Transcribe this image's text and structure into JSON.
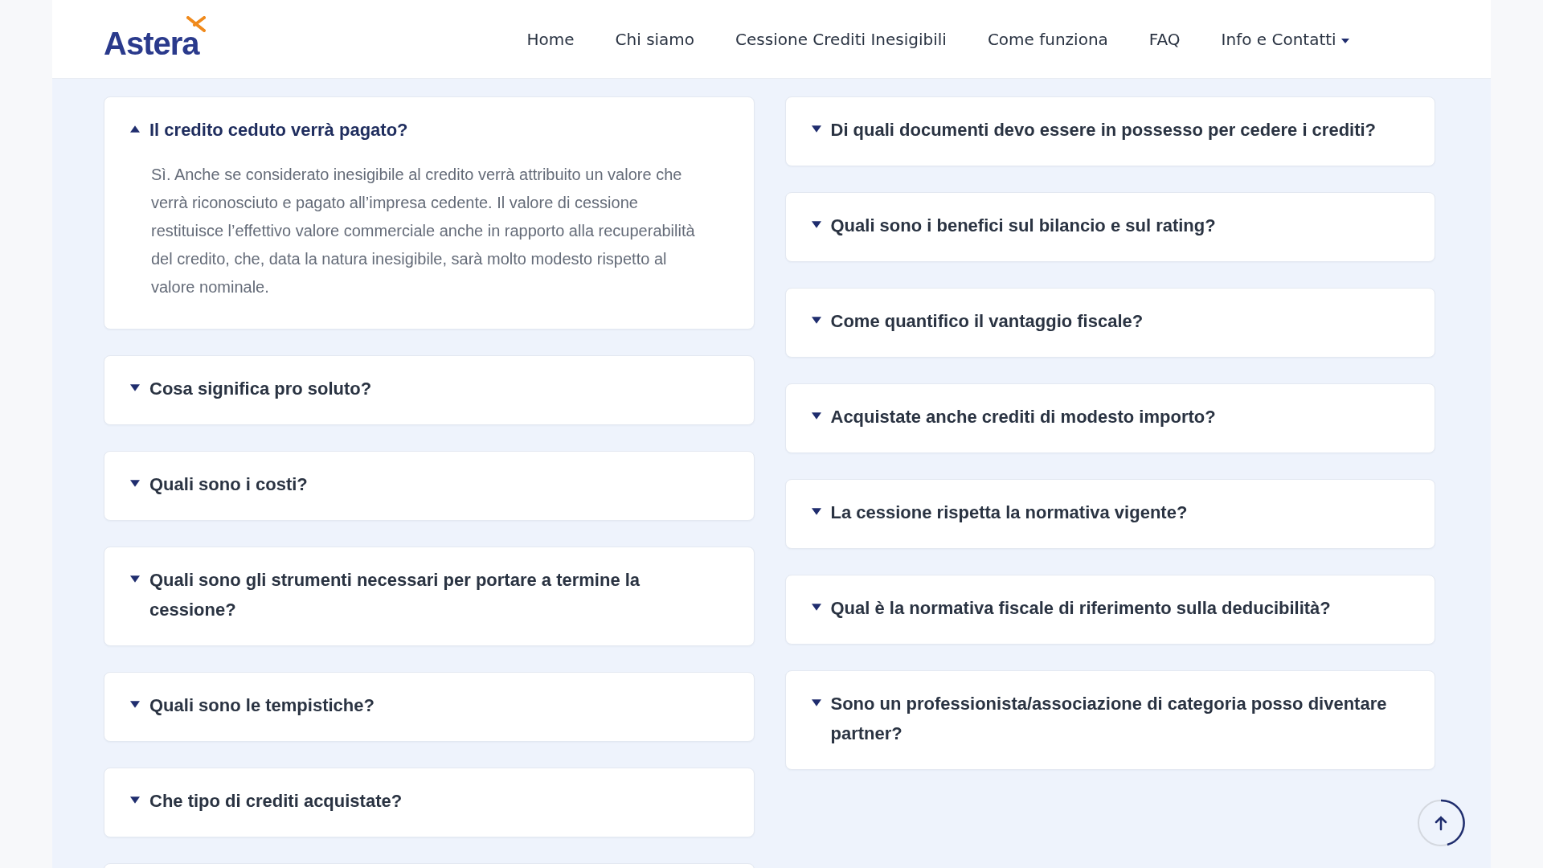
{
  "logo": {
    "name": "Astera"
  },
  "nav": [
    {
      "label": "Home",
      "dropdown": false
    },
    {
      "label": "Chi siamo",
      "dropdown": false
    },
    {
      "label": "Cessione Crediti Inesigibili",
      "dropdown": false
    },
    {
      "label": "Come funziona",
      "dropdown": false
    },
    {
      "label": "FAQ",
      "dropdown": false
    },
    {
      "label": "Info e Contatti",
      "dropdown": true
    }
  ],
  "faq_left": [
    {
      "question": "Il credito ceduto verrà pagato?",
      "expanded": true,
      "answer": "Sì. Anche se considerato inesigibile al credito verrà attribuito un valore che verrà riconosciuto e pagato all’impresa cedente. Il valore di cessione restituisce l’effettivo valore commerciale anche in rapporto alla recuperabilità del credito, che, data la natura inesigibile, sarà molto modesto rispetto al valore nominale."
    },
    {
      "question": "Cosa significa pro soluto?",
      "expanded": false
    },
    {
      "question": "Quali sono i costi?",
      "expanded": false
    },
    {
      "question": "Quali sono gli strumenti necessari per portare a termine la cessione?",
      "expanded": false
    },
    {
      "question": "Quali sono le tempistiche?",
      "expanded": false
    },
    {
      "question": "Che tipo di crediti acquistate?",
      "expanded": false
    }
  ],
  "faq_right": [
    {
      "question": "Di quali documenti devo essere in possesso per cedere i crediti?",
      "expanded": false
    },
    {
      "question": "Quali sono i benefici sul bilancio e sul rating?",
      "expanded": false
    },
    {
      "question": "Come quantifico il vantaggio fiscale?",
      "expanded": false
    },
    {
      "question": "Acquistate anche crediti di modesto importo?",
      "expanded": false
    },
    {
      "question": "La cessione rispetta la normativa vigente?",
      "expanded": false
    },
    {
      "question": "Qual è la normativa fiscale di riferimento sulla deducibilità?",
      "expanded": false
    },
    {
      "question": "Sono un professionista/associazione di categoria posso diventare partner?",
      "expanded": false
    }
  ]
}
